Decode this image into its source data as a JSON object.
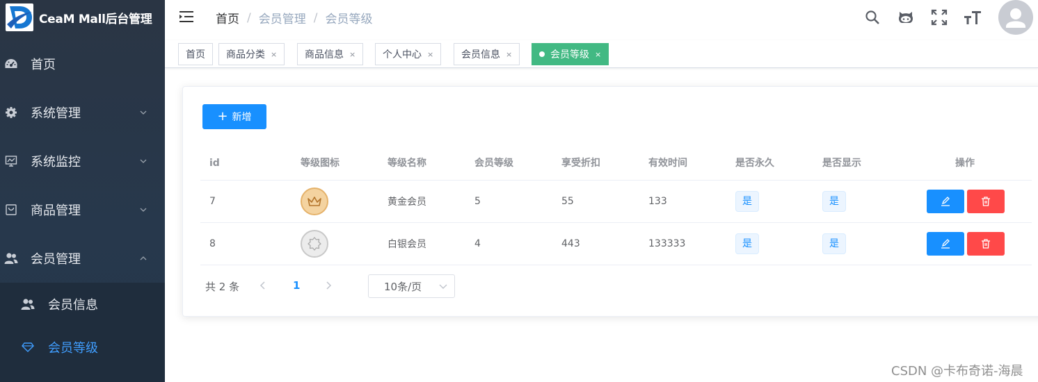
{
  "app": {
    "title": "CeaM Mall后台管理"
  },
  "sidebar": {
    "items": [
      {
        "label": "首页",
        "icon": "dashboard-icon"
      },
      {
        "label": "系统管理",
        "icon": "gear-icon"
      },
      {
        "label": "系统监控",
        "icon": "monitor-icon"
      },
      {
        "label": "商品管理",
        "icon": "goods-icon"
      },
      {
        "label": "会员管理",
        "icon": "users-icon"
      }
    ],
    "submenu": [
      {
        "label": "会员信息",
        "icon": "user-group-icon"
      },
      {
        "label": "会员等级",
        "icon": "diamond-icon",
        "active": true
      }
    ]
  },
  "breadcrumb": {
    "home": "首页",
    "parent": "会员管理",
    "current": "会员等级",
    "separator": "/"
  },
  "tags": [
    {
      "label": "首页",
      "closable": false
    },
    {
      "label": "商品分类",
      "closable": true
    },
    {
      "label": "商品信息",
      "closable": true
    },
    {
      "label": "个人中心",
      "closable": true
    },
    {
      "label": "会员信息",
      "closable": true
    },
    {
      "label": "会员等级",
      "closable": true,
      "active": true
    }
  ],
  "tag_close": "×",
  "toolbar": {
    "add_label": "新增",
    "add_icon": "+"
  },
  "table": {
    "headers": [
      "id",
      "等级图标",
      "等级名称",
      "会员等级",
      "享受折扣",
      "有效时间",
      "是否永久",
      "是否显示",
      "操作"
    ],
    "rows": [
      {
        "id": "7",
        "icon": "gold-crown-icon",
        "name": "黄金会员",
        "level": "5",
        "discount": "55",
        "valid_time": "133",
        "permanent": "是",
        "visible": "是"
      },
      {
        "id": "8",
        "icon": "silver-badge-icon",
        "name": "白银会员",
        "level": "4",
        "discount": "443",
        "valid_time": "133333",
        "permanent": "是",
        "visible": "是"
      }
    ]
  },
  "pagination": {
    "total": "共 2 条",
    "page": "1",
    "page_size": "10条/页"
  },
  "watermark": "CSDN @卡布奇诺-海晨",
  "colors": {
    "primary": "#1890ff",
    "danger": "#ff4949",
    "tag_active": "#42b983",
    "sidebar_bg": "#2a3544",
    "submenu_bg": "#1f2d3d"
  }
}
